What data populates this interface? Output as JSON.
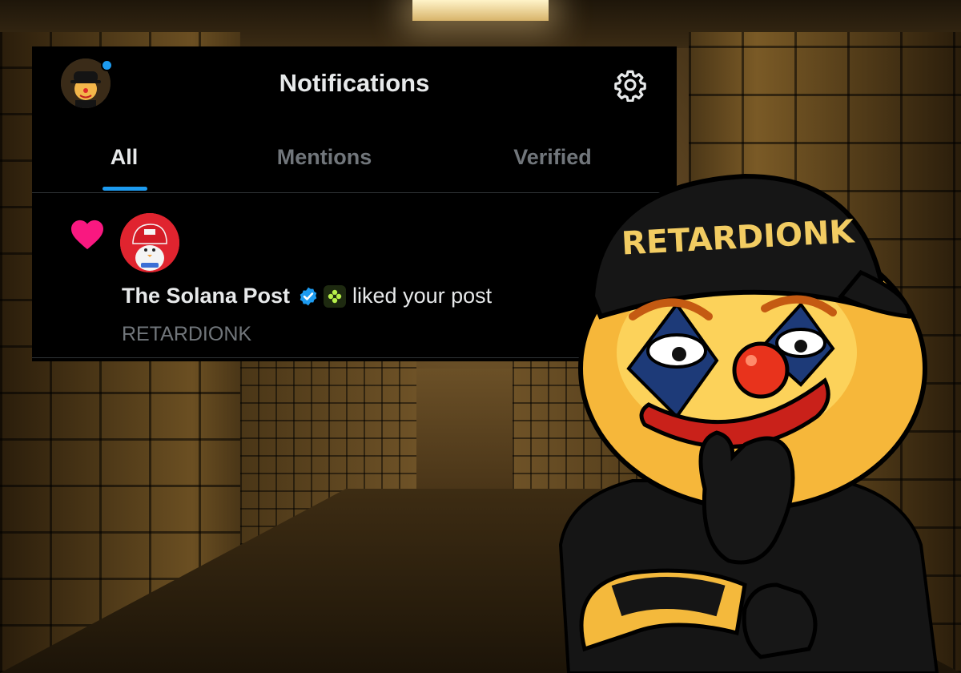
{
  "header": {
    "title": "Notifications"
  },
  "tabs": [
    {
      "label": "All",
      "active": true
    },
    {
      "label": "Mentions",
      "active": false
    },
    {
      "label": "Verified",
      "active": false
    }
  ],
  "notification": {
    "icon": "heart-icon",
    "actor_name": "The Solana Post",
    "action": "liked your post",
    "post_text": "RETARDIONK"
  },
  "mascot": {
    "cap_text": "RETARDIONK"
  },
  "colors": {
    "accent": "#1d9bf0",
    "heart": "#f91880",
    "panel_bg": "#000000",
    "text_primary": "#e7e9ea",
    "text_secondary": "#71767b"
  }
}
